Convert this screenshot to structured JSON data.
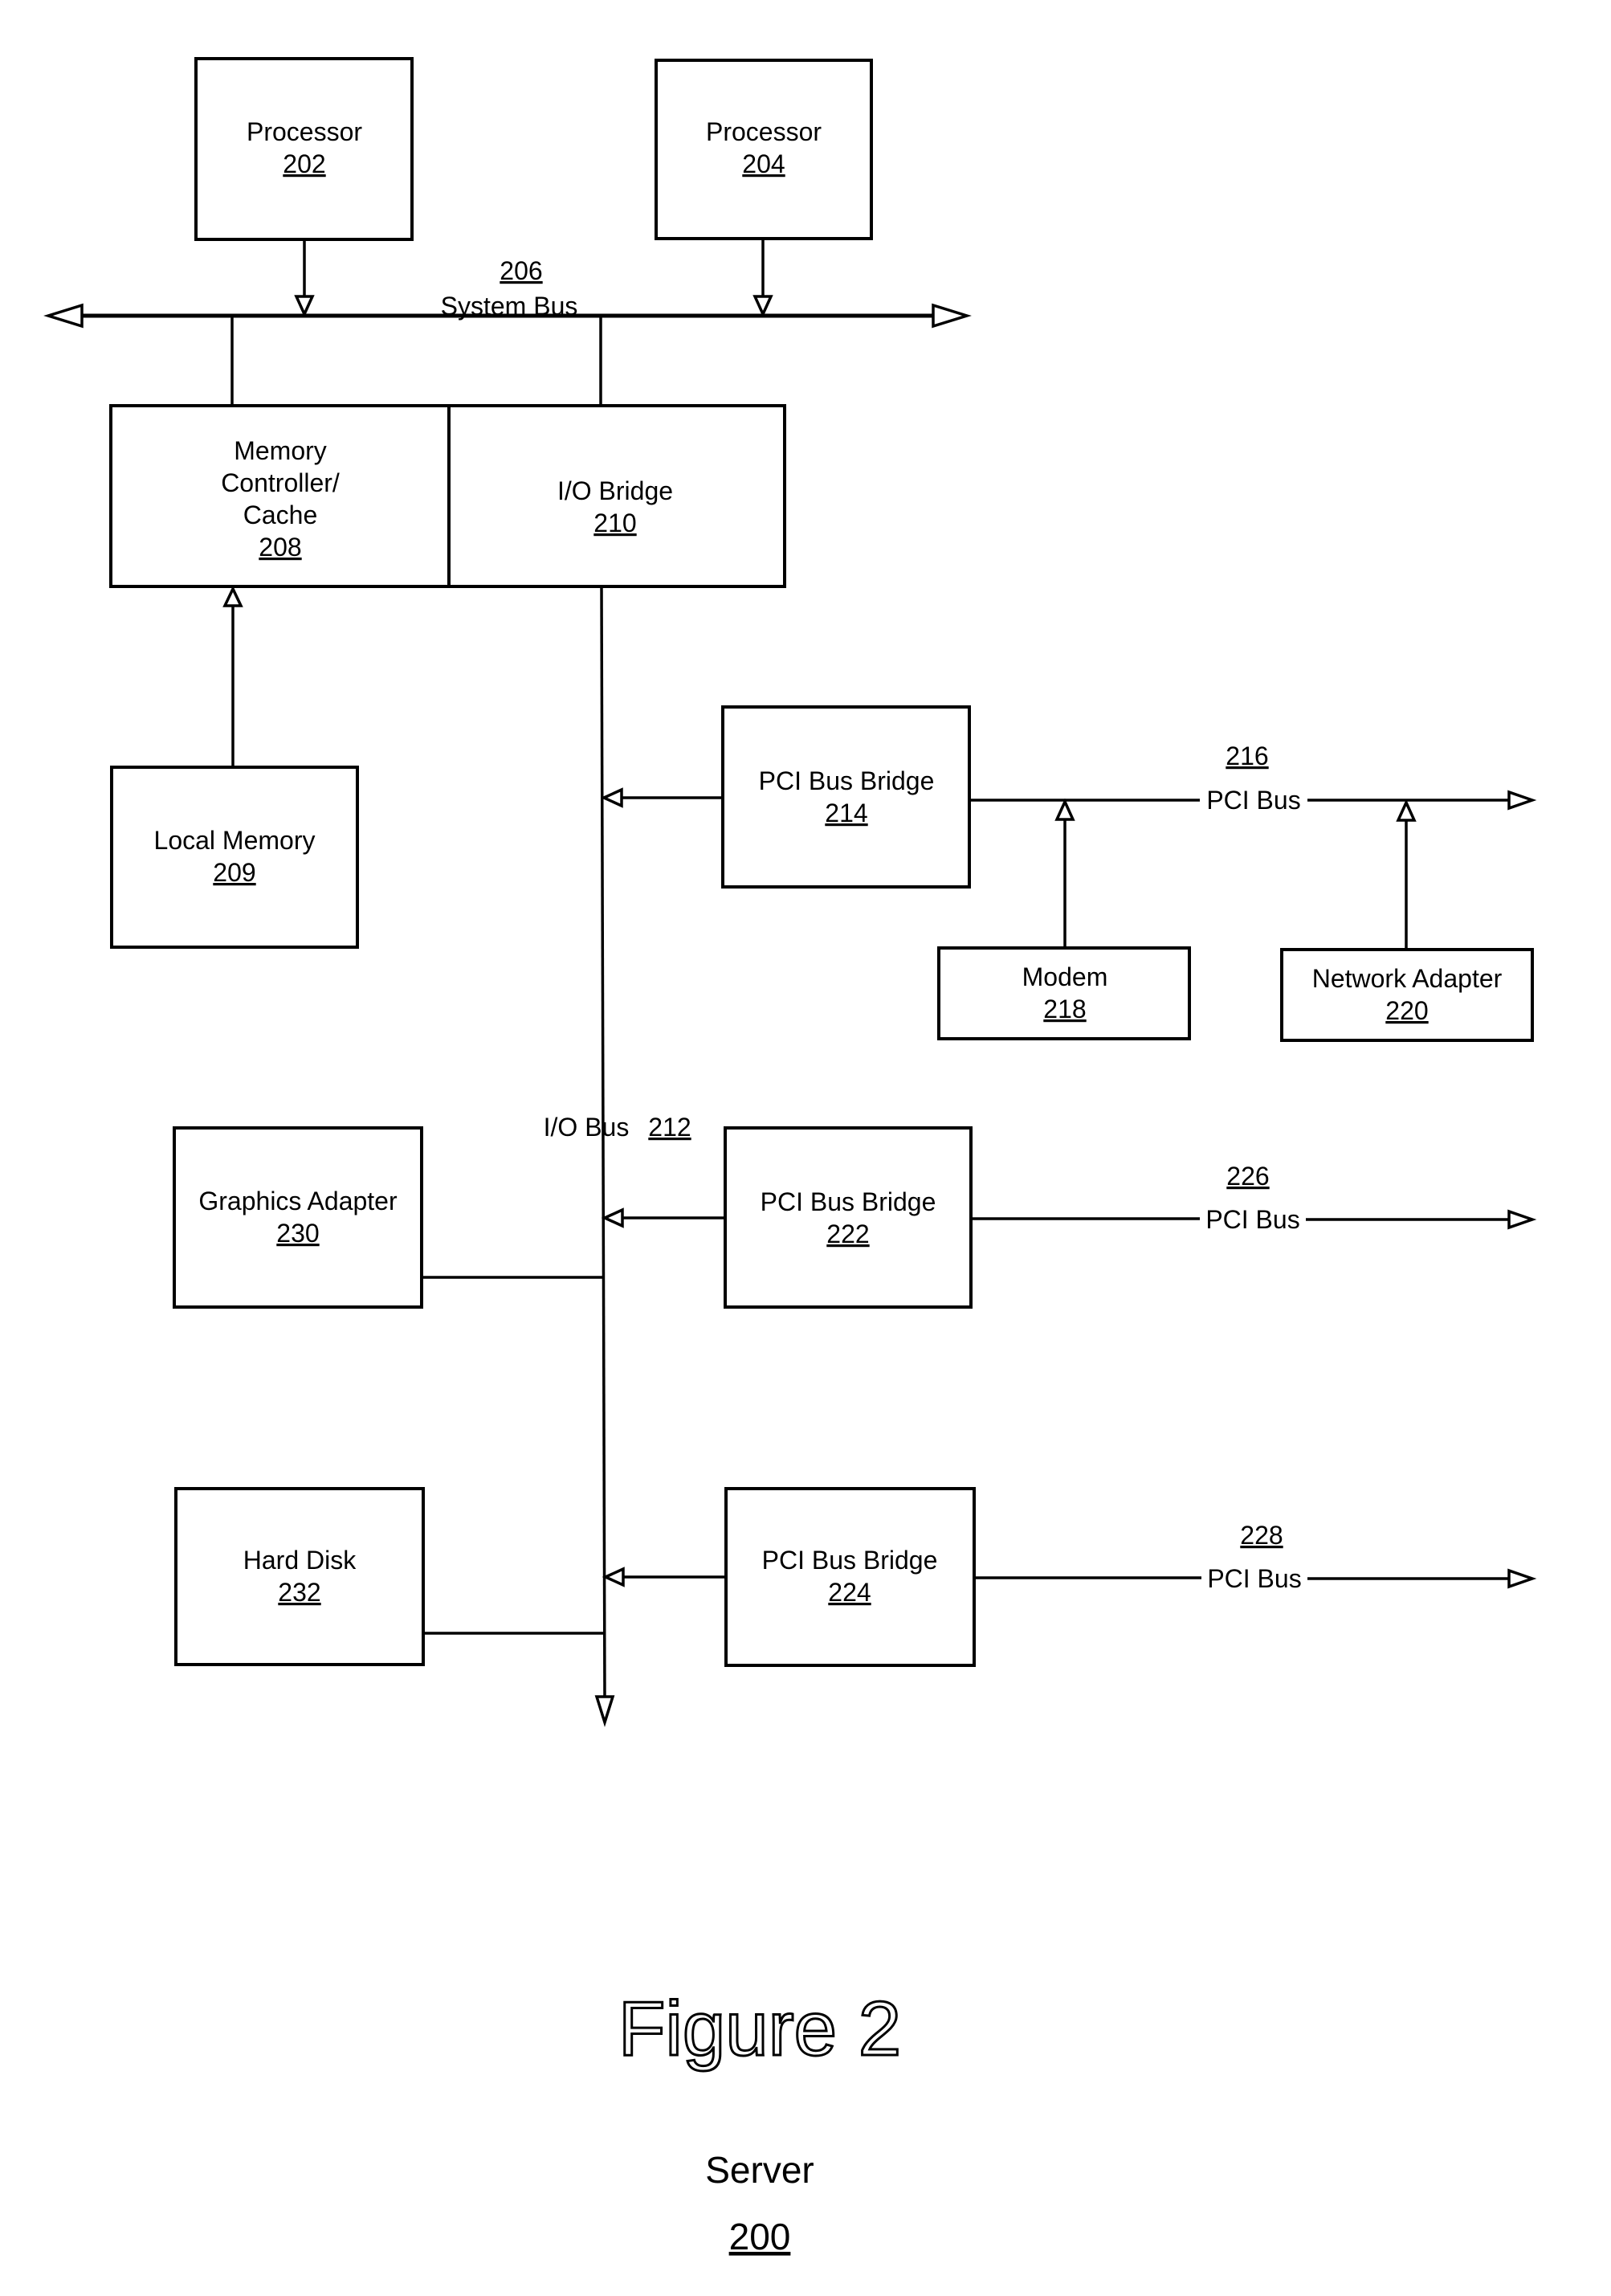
{
  "figure": {
    "title": "Figure 2",
    "caption": "Server",
    "caption_number": "200"
  },
  "system_bus": {
    "label": "System Bus",
    "number": "206"
  },
  "io_bus": {
    "label": "I/O Bus",
    "number": "212"
  },
  "components": {
    "processor_202": {
      "lines": [
        "Processor"
      ],
      "number": "202"
    },
    "processor_204": {
      "lines": [
        "Processor"
      ],
      "number": "204"
    },
    "memory_controller_208": {
      "lines": [
        "Memory",
        "Controller/",
        "Cache"
      ],
      "number": "208"
    },
    "io_bridge_210": {
      "lines": [
        "I/O Bridge"
      ],
      "number": "210"
    },
    "local_memory_209": {
      "lines": [
        "Local Memory"
      ],
      "number": "209"
    },
    "pci_bus_bridge_214": {
      "lines": [
        "PCI Bus Bridge"
      ],
      "number": "214"
    },
    "modem_218": {
      "lines": [
        "Modem"
      ],
      "number": "218"
    },
    "network_adapter_220": {
      "lines": [
        "Network Adapter"
      ],
      "number": "220"
    },
    "graphics_adapter_230": {
      "lines": [
        "Graphics Adapter"
      ],
      "number": "230"
    },
    "pci_bus_bridge_222": {
      "lines": [
        "PCI Bus Bridge"
      ],
      "number": "222"
    },
    "hard_disk_232": {
      "lines": [
        "Hard Disk"
      ],
      "number": "232"
    },
    "pci_bus_bridge_224": {
      "lines": [
        "PCI Bus Bridge"
      ],
      "number": "224"
    }
  },
  "pci_buses": {
    "pci_bus_216": {
      "label": "PCI Bus",
      "number": "216"
    },
    "pci_bus_226": {
      "label": "PCI Bus",
      "number": "226"
    },
    "pci_bus_228": {
      "label": "PCI Bus",
      "number": "228"
    }
  }
}
